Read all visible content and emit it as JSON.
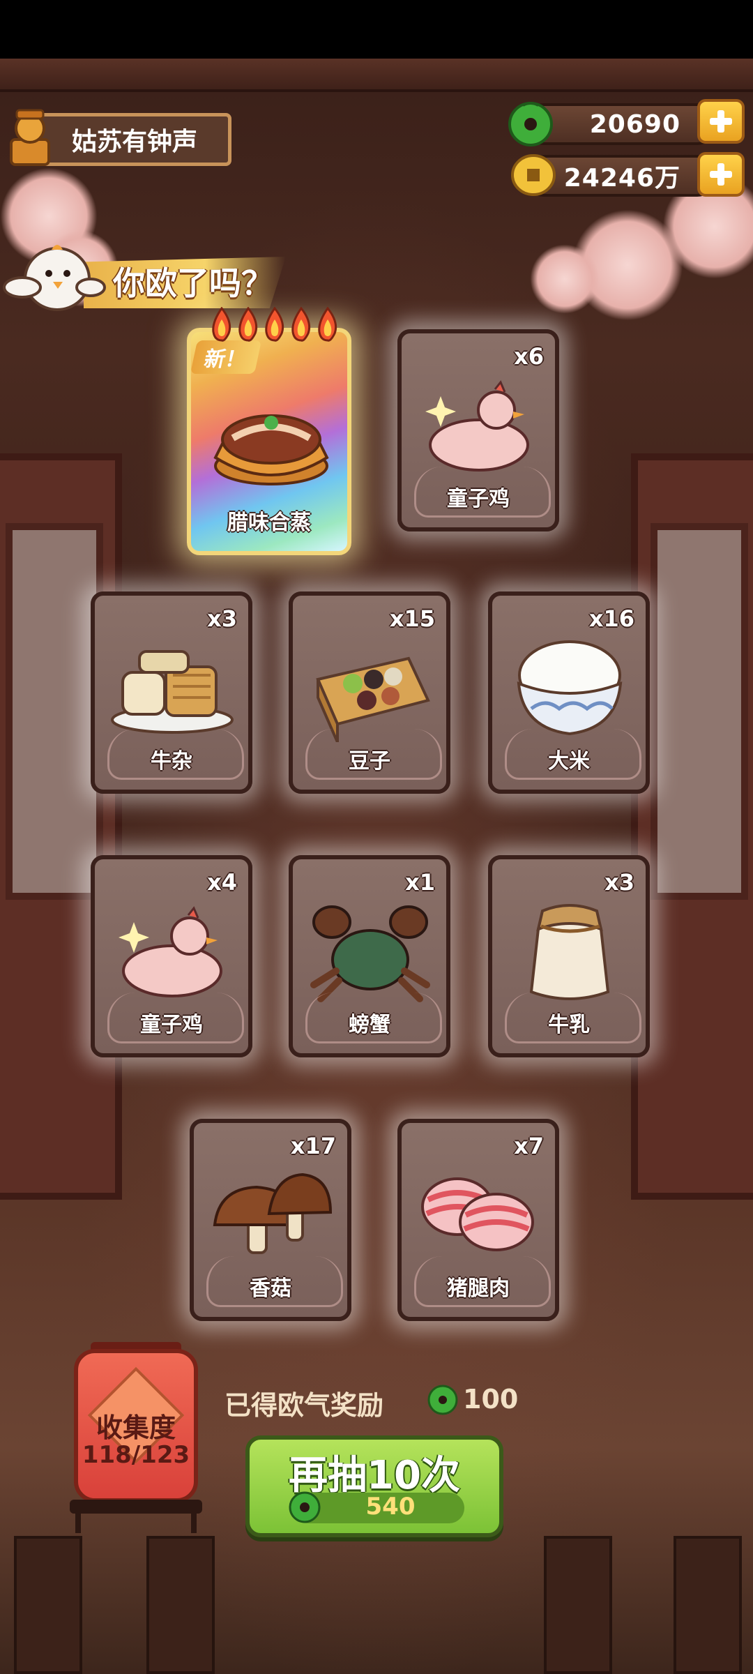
{
  "player": {
    "name": "姑苏有钟声"
  },
  "currency": {
    "jade": "20690",
    "coins": "24246万"
  },
  "banner": {
    "text": "你欧了吗？"
  },
  "new_card": {
    "badge": "新！",
    "label": "腊味合蒸",
    "flames": 5
  },
  "cards": [
    {
      "label": "童子鸡",
      "count": "x6",
      "icon": "chicken-icon"
    },
    {
      "label": "牛杂",
      "count": "x3",
      "icon": "beef-offal-icon"
    },
    {
      "label": "豆子",
      "count": "x15",
      "icon": "beans-icon"
    },
    {
      "label": "大米",
      "count": "x16",
      "icon": "rice-bowl-icon"
    },
    {
      "label": "童子鸡",
      "count": "x4",
      "icon": "chicken-icon"
    },
    {
      "label": "螃蟹",
      "count": "x1",
      "icon": "crab-icon"
    },
    {
      "label": "牛乳",
      "count": "x3",
      "icon": "milk-jar-icon"
    },
    {
      "label": "香菇",
      "count": "x17",
      "icon": "mushroom-icon"
    },
    {
      "label": "猪腿肉",
      "count": "x7",
      "icon": "pork-icon"
    }
  ],
  "collection": {
    "title": "收集度",
    "value": "118/123"
  },
  "reward": {
    "label": "已得欧气奖励",
    "value": "100"
  },
  "draw_button": {
    "label": "再抽10次",
    "cost": "540"
  }
}
